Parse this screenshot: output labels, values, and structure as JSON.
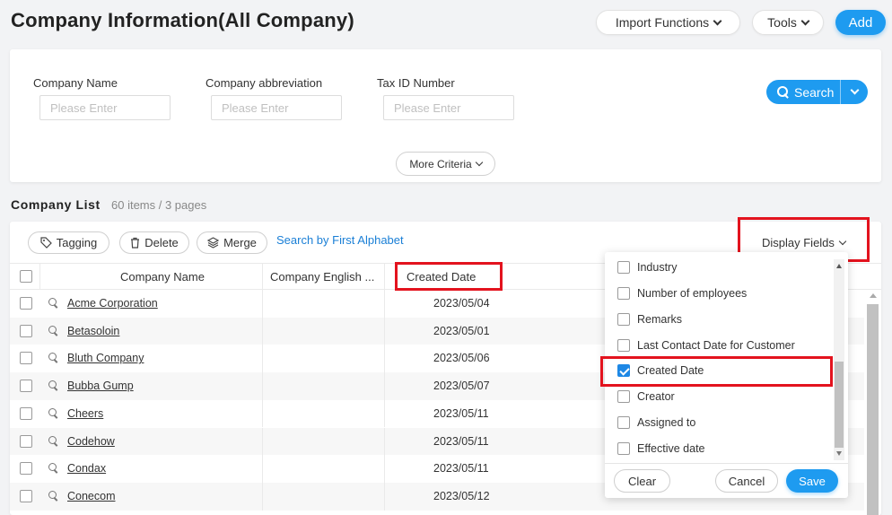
{
  "header": {
    "title": "Company Information(All Company)",
    "import_label": "Import Functions",
    "tools_label": "Tools",
    "add_label": "Add"
  },
  "criteria": {
    "fields": [
      {
        "label": "Company Name",
        "placeholder": "Please Enter"
      },
      {
        "label": "Company abbreviation",
        "placeholder": "Please Enter"
      },
      {
        "label": "Tax ID Number",
        "placeholder": "Please Enter"
      }
    ],
    "search_label": "Search",
    "more_label": "More Criteria"
  },
  "list": {
    "title": "Company List",
    "count": "60 items / 3 pages",
    "toolbar": {
      "tagging": "Tagging",
      "delete": "Delete",
      "merge": "Merge",
      "alphabet_link": "Search by First Alphabet",
      "display_fields": "Display Fields"
    },
    "columns": [
      "Company Name",
      "Company English ...",
      "Created Date"
    ],
    "rows": [
      {
        "name": "Acme Corporation",
        "date": "2023/05/04"
      },
      {
        "name": "Betasoloin",
        "date": "2023/05/01"
      },
      {
        "name": "Bluth Company",
        "date": "2023/05/06"
      },
      {
        "name": "Bubba Gump",
        "date": "2023/05/07"
      },
      {
        "name": "Cheers",
        "date": "2023/05/11"
      },
      {
        "name": "Codehow",
        "date": "2023/05/11"
      },
      {
        "name": "Condax",
        "date": "2023/05/11"
      },
      {
        "name": "Conecom",
        "date": "2023/05/12"
      }
    ]
  },
  "display_fields_menu": {
    "items": [
      {
        "label": "Industry",
        "checked": false
      },
      {
        "label": "Number of employees",
        "checked": false
      },
      {
        "label": "Remarks",
        "checked": false
      },
      {
        "label": "Last Contact Date for Customer",
        "checked": false
      },
      {
        "label": "Created Date",
        "checked": true
      },
      {
        "label": "Creator",
        "checked": false
      },
      {
        "label": "Assigned to",
        "checked": false
      },
      {
        "label": "Effective date",
        "checked": false
      }
    ],
    "clear_label": "Clear",
    "cancel_label": "Cancel",
    "save_label": "Save"
  },
  "colors": {
    "accent": "#1e9bf0",
    "highlight": "#e3131e",
    "link": "#1a7fd6"
  }
}
